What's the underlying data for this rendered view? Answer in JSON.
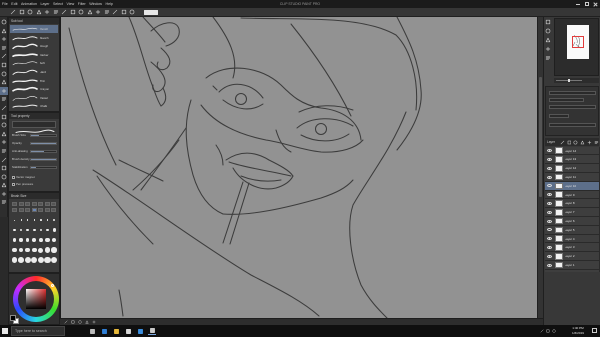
{
  "window": {
    "title": "CLIP STUDIO PAINT PRO",
    "menu": [
      "File",
      "Edit",
      "Animation",
      "Layer",
      "Select",
      "View",
      "Filter",
      "Window",
      "Help"
    ],
    "controls": [
      "minimize-icon",
      "maximize-icon",
      "close-icon"
    ]
  },
  "command_bar": {
    "icons": [
      "new-file-icon",
      "open-file-icon",
      "save-icon",
      "undo-icon",
      "redo-icon",
      "clear-icon",
      "cut-icon",
      "copy-icon",
      "paste-icon",
      "transform-icon",
      "deselect-icon",
      "invert-selection-icon",
      "show-selection-icon",
      "snap-ruler-icon",
      "snap-grid-icon"
    ]
  },
  "tools": {
    "icons": [
      "zoom-icon",
      "hand-icon",
      "operation-icon",
      "move-layer-icon",
      "selection-icon",
      "auto-select-icon",
      "eyedropper-icon",
      "pen-icon",
      "pencil-icon",
      "brush-icon",
      "airbrush-icon",
      "decoration-icon",
      "eraser-icon",
      "blend-icon",
      "fill-icon",
      "gradient-icon",
      "figure-icon",
      "frame-icon",
      "ruler-icon",
      "text-icon",
      "balloon-icon",
      "correct-line-icon"
    ],
    "selected_index": 8
  },
  "sub_tool": {
    "header": "Sub tool",
    "selected_index": 0,
    "items": [
      {
        "label": "Pencil"
      },
      {
        "label": "Sketch"
      },
      {
        "label": "Rough"
      },
      {
        "label": "Darker"
      },
      {
        "label": "Soft"
      },
      {
        "label": "Hard"
      },
      {
        "label": "Thin"
      },
      {
        "label": "Crayon"
      },
      {
        "label": "Pastel"
      },
      {
        "label": "Chalk"
      }
    ]
  },
  "tool_property": {
    "header": "Tool property",
    "rows": [
      {
        "label": "Brush Size",
        "level": 0.3
      },
      {
        "label": "Opacity",
        "level": 1.0
      },
      {
        "label": "Anti-aliasing",
        "level": 0.5
      },
      {
        "label": "Brush density",
        "level": 1.0
      },
      {
        "label": "Stabilization",
        "level": 0.2
      }
    ],
    "checks": [
      {
        "label": "Vector magnet"
      },
      {
        "label": "Pen pressure"
      }
    ]
  },
  "brush_size_palette": {
    "header": "Brush Size",
    "preset_selected_index": 3,
    "dot_rows": 5,
    "dot_cols": 7
  },
  "color": {
    "main": "#000000",
    "sub": "#ffffff",
    "hue": "#e03030"
  },
  "right_panel": {
    "icons": [
      "navigator-icon",
      "sub-view-icon",
      "item-bank-icon",
      "history-icon",
      "layer-property-icon"
    ],
    "layer_header": "Layer",
    "layer_tools": [
      "new-raster-layer-icon",
      "new-vector-layer-icon",
      "new-folder-icon",
      "copy-layer-icon",
      "merge-down-icon",
      "delete-layer-icon"
    ],
    "selected_layer_index": 4,
    "layers": [
      {
        "name": "Layer 14"
      },
      {
        "name": "Layer 13"
      },
      {
        "name": "Layer 12"
      },
      {
        "name": "Layer 11"
      },
      {
        "name": "Layer 10"
      },
      {
        "name": "Layer 9"
      },
      {
        "name": "Layer 8"
      },
      {
        "name": "Layer 7"
      },
      {
        "name": "Layer 6"
      },
      {
        "name": "Layer 5"
      },
      {
        "name": "Layer 4"
      },
      {
        "name": "Layer 3"
      },
      {
        "name": "Layer 2"
      },
      {
        "name": "Layer 1"
      }
    ]
  },
  "status_bar": {
    "icons": [
      "fit-view-icon",
      "rotate-view-icon",
      "flip-view-icon",
      "zoom-out-icon",
      "zoom-in-icon"
    ]
  },
  "taskbar": {
    "search_placeholder": "Type here to search",
    "apps": [
      "task-view-icon",
      "edge-browser-icon",
      "file-explorer-icon",
      "store-icon",
      "mail-icon",
      "clip-studio-icon"
    ],
    "active_app_index": 5,
    "tray_icons": [
      "chevron-up-icon",
      "network-icon",
      "volume-icon"
    ],
    "time": "1:40 PM",
    "date": "1/3/2019"
  },
  "colors": {
    "selection": "#5d6f8a",
    "canvas": "#929292",
    "sketch_line": "#3c3c3c"
  }
}
